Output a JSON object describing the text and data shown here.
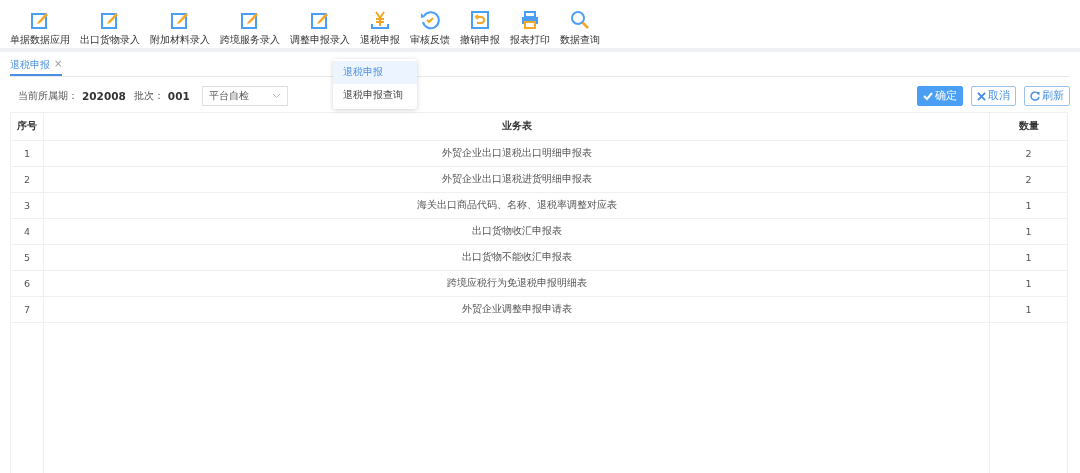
{
  "toolbar": [
    {
      "label": "单据数据应用",
      "kind": "edit"
    },
    {
      "label": "出口货物录入",
      "kind": "edit"
    },
    {
      "label": "附加材料录入",
      "kind": "edit"
    },
    {
      "label": "跨境服务录入",
      "kind": "edit"
    },
    {
      "label": "调整申报录入",
      "kind": "edit"
    },
    {
      "label": "退税申报",
      "kind": "yen"
    },
    {
      "label": "审核反馈",
      "kind": "refresh"
    },
    {
      "label": "撤销申报",
      "kind": "undo"
    },
    {
      "label": "报表打印",
      "kind": "print"
    },
    {
      "label": "数据查询",
      "kind": "search"
    }
  ],
  "tabs": [
    {
      "label": "退税申报",
      "close": "×",
      "selected": true
    }
  ],
  "dropdown": [
    {
      "label": "退税申报",
      "selected": true
    },
    {
      "label": "退税申报查询",
      "selected": false
    }
  ],
  "period_label": "当前所属期：",
  "period": "202008",
  "batch_label": "批次：",
  "batch": "001",
  "select": {
    "value": "平台自检"
  },
  "buttons": [
    {
      "label": "确定",
      "kind": "primary"
    },
    {
      "label": "取消",
      "kind": "cancel"
    },
    {
      "label": "刷新",
      "kind": "refresh"
    }
  ],
  "table": {
    "columns": [
      "序号",
      "业务表",
      "数量"
    ],
    "rows": [
      [
        "1",
        "外贸企业出口退税出口明细申报表",
        "2"
      ],
      [
        "2",
        "外贸企业出口退税进货明细申报表",
        "2"
      ],
      [
        "3",
        "海关出口商品代码、名称、退税率调整对应表",
        "1"
      ],
      [
        "4",
        "出口货物收汇申报表",
        "1"
      ],
      [
        "5",
        "出口货物不能收汇申报表",
        "1"
      ],
      [
        "6",
        "跨境应税行为免退税申报明细表",
        "1"
      ],
      [
        "7",
        "外贸企业调整申报申请表",
        "1"
      ]
    ]
  }
}
